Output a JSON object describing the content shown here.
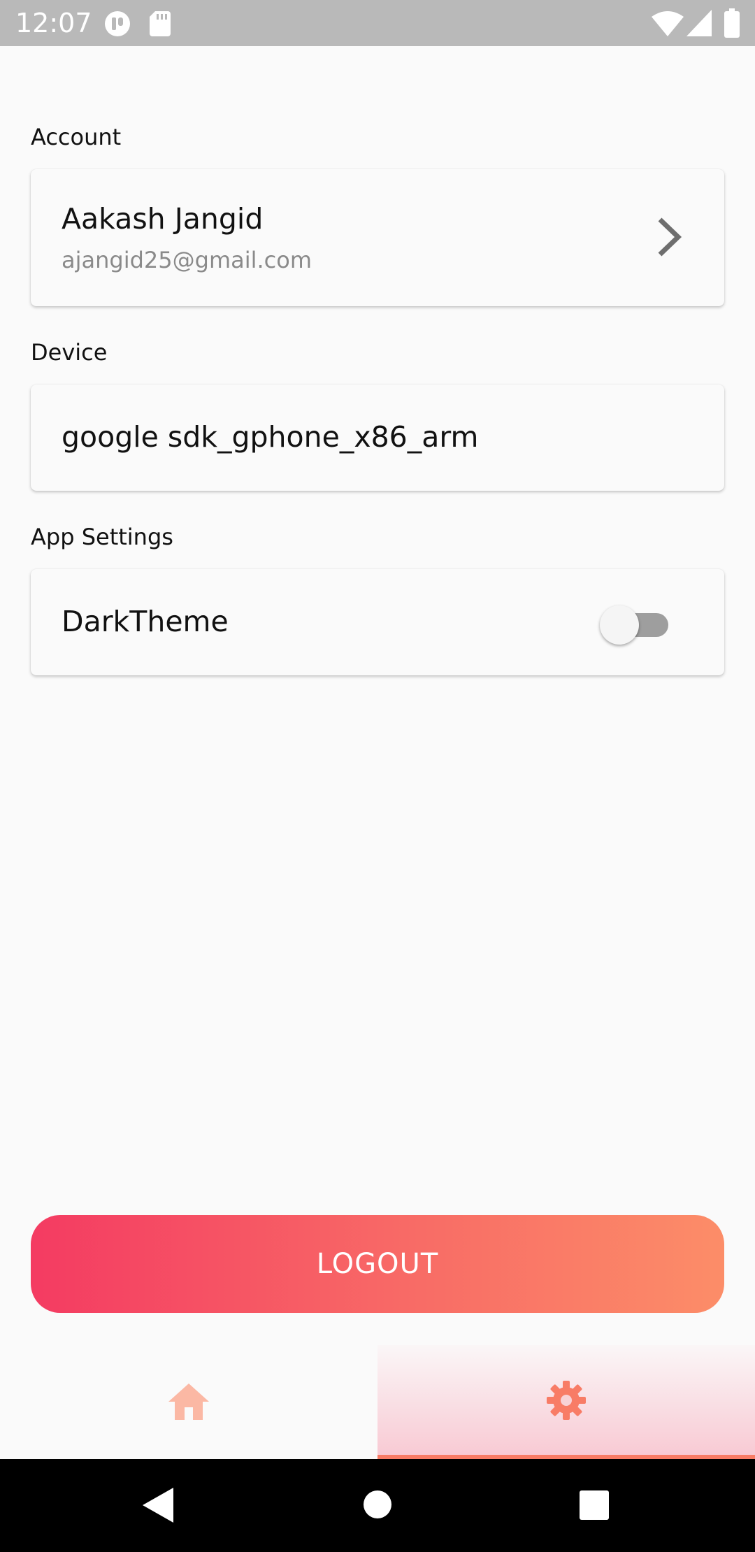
{
  "status_bar": {
    "time": "12:07",
    "icons": [
      "app-notification-icon",
      "sd-card-icon",
      "wifi-icon",
      "signal-icon",
      "battery-icon"
    ]
  },
  "sections": {
    "account_label": "Account",
    "device_label": "Device",
    "app_settings_label": "App Settings"
  },
  "account": {
    "name": "Aakash Jangid",
    "email": "ajangid25@gmail.com"
  },
  "device": {
    "name": "google sdk_gphone_x86_arm"
  },
  "app_settings": {
    "dark_theme_label": "DarkTheme",
    "dark_theme_enabled": false
  },
  "logout": {
    "label": "LOGOUT"
  },
  "bottom_nav": {
    "items": [
      {
        "name": "home",
        "icon": "home-icon",
        "selected": false
      },
      {
        "name": "settings",
        "icon": "gear-icon",
        "selected": true
      }
    ]
  },
  "colors": {
    "accent_start": "#f43b62",
    "accent_end": "#fc8d68",
    "nav_icon": "#f87c66"
  }
}
